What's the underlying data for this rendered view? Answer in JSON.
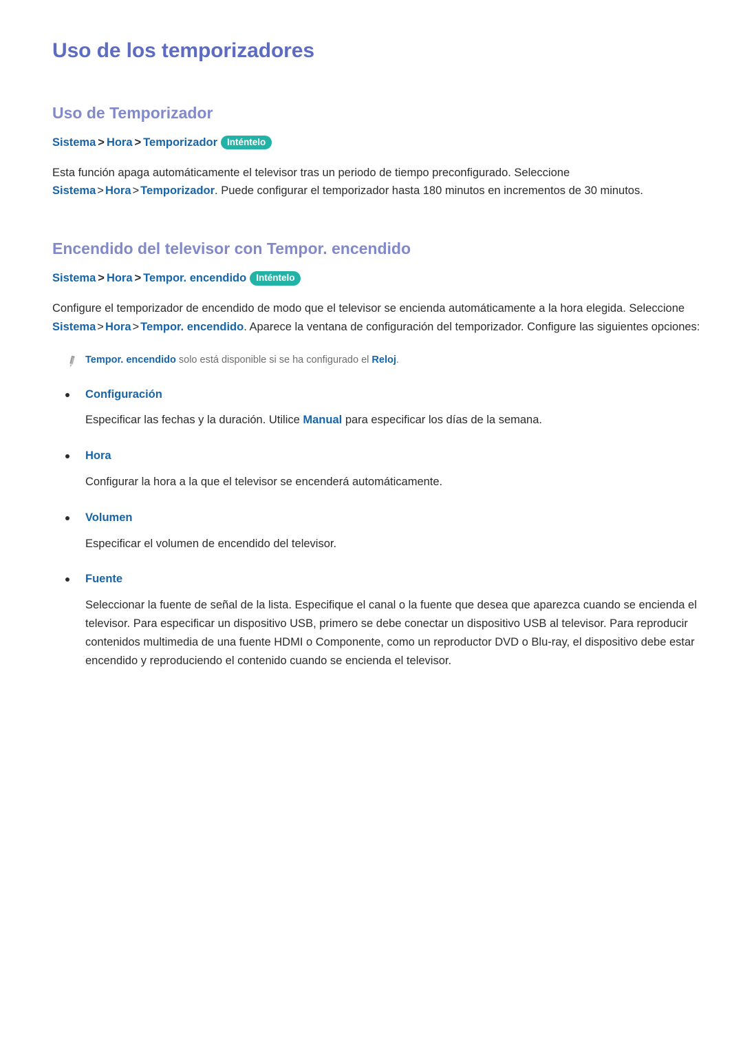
{
  "page": {
    "title": "Uso de los temporizadores"
  },
  "badge_label": "Inténtelo",
  "separator": ">",
  "sections": [
    {
      "heading": "Uso de Temporizador",
      "breadcrumb": [
        "Sistema",
        "Hora",
        "Temporizador"
      ],
      "paragraph": {
        "part1": "Esta función apaga automáticamente el televisor tras un periodo de tiempo preconfigurado. Seleccione ",
        "ref1": "Sistema",
        "ref2": "Hora",
        "ref3": "Temporizador",
        "part2": ". Puede configurar el temporizador hasta 180 minutos en incrementos de 30 minutos."
      }
    },
    {
      "heading": "Encendido del televisor con Tempor. encendido",
      "breadcrumb": [
        "Sistema",
        "Hora",
        "Tempor. encendido"
      ],
      "paragraph": {
        "part1": "Configure el temporizador de encendido de modo que el televisor se encienda automáticamente a la hora elegida. Seleccione ",
        "ref1": "Sistema",
        "ref2": "Hora",
        "ref3": "Tempor. encendido",
        "part2": ". Aparece la ventana de configuración del temporizador. Configure las siguientes opciones:"
      },
      "note": {
        "icon": "pencil-icon",
        "ref1": "Tempor. encendido",
        "text1": " solo está disponible si se ha configurado el ",
        "ref2": "Reloj",
        "text2": "."
      },
      "bullets": [
        {
          "label": "Configuración",
          "body_part1": "Especificar las fechas y la duración. Utilice ",
          "body_ref": "Manual",
          "body_part2": " para especificar los días de la semana."
        },
        {
          "label": "Hora",
          "body_part1": "Configurar la hora a la que el televisor se encenderá automáticamente.",
          "body_ref": "",
          "body_part2": ""
        },
        {
          "label": "Volumen",
          "body_part1": "Especificar el volumen de encendido del televisor.",
          "body_ref": "",
          "body_part2": ""
        },
        {
          "label": "Fuente",
          "body_part1": "Seleccionar la fuente de señal de la lista. Especifique el canal o la fuente que desea que aparezca cuando se encienda el televisor. Para especificar un dispositivo USB, primero se debe conectar un dispositivo USB al televisor. Para reproducir contenidos multimedia de una fuente HDMI o Componente, como un reproductor DVD o Blu-ray, el dispositivo debe estar encendido y reproduciendo el contenido cuando se encienda el televisor.",
          "body_ref": "",
          "body_part2": ""
        }
      ]
    }
  ],
  "colors": {
    "page_title": "#5d6cc0",
    "section_title": "#8289c9",
    "menu_ref_blue": "#1765a8",
    "badge_teal": "#22b2a6",
    "body_text": "#2b2b2b",
    "note_text": "#6e6e6e"
  }
}
